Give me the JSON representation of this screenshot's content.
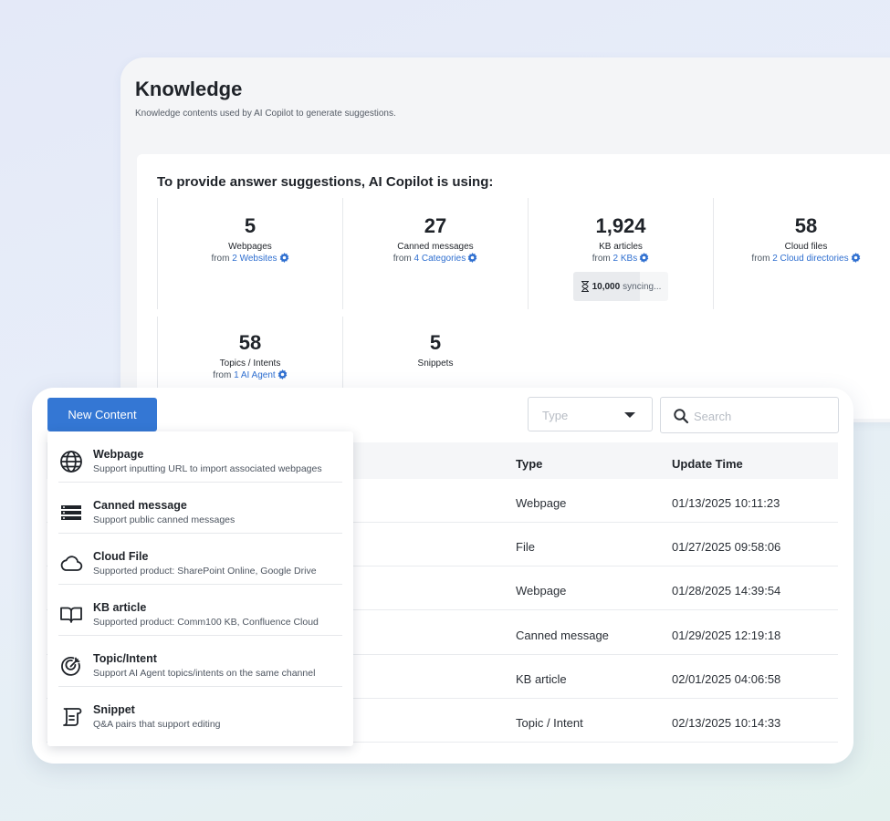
{
  "knowledge": {
    "title": "Knowledge",
    "subtitle": "Knowledge contents used by AI Copilot to generate suggestions."
  },
  "stats": {
    "heading": "To provide answer suggestions, AI Copilot is using:",
    "items": [
      {
        "count": "5",
        "label": "Webpages",
        "from_prefix": "from",
        "from_link": "2 Websites"
      },
      {
        "count": "27",
        "label": "Canned messages",
        "from_prefix": "from",
        "from_link": "4 Categories"
      },
      {
        "count": "1,924",
        "label": "KB articles",
        "from_prefix": "from",
        "from_link": "2 KBs"
      },
      {
        "count": "58",
        "label": "Cloud files",
        "from_prefix": "from",
        "from_link": "2 Cloud directories"
      },
      {
        "count": "58",
        "label": "Topics / Intents",
        "from_prefix": "from",
        "from_link": "1 AI Agent"
      },
      {
        "count": "5",
        "label": "Snippets"
      }
    ],
    "sync": {
      "count": "10,000",
      "text": "syncing..."
    }
  },
  "toolbar": {
    "new_content": "New Content",
    "type_placeholder": "Type",
    "search_placeholder": "Search"
  },
  "menu": {
    "items": [
      {
        "title": "Webpage",
        "desc": "Support inputting URL to import associated webpages",
        "icon": "globe-icon"
      },
      {
        "title": "Canned message",
        "desc": "Support public canned messages",
        "icon": "canned-message-icon"
      },
      {
        "title": "Cloud File",
        "desc": "Supported product: SharePoint Online, Google Drive",
        "icon": "cloud-icon"
      },
      {
        "title": "KB article",
        "desc": "Supported product: Comm100 KB, Confluence Cloud",
        "icon": "book-icon"
      },
      {
        "title": "Topic/Intent",
        "desc": "Support AI Agent topics/intents on the same channel",
        "icon": "target-icon"
      },
      {
        "title": "Snippet",
        "desc": "Q&A pairs that support editing",
        "icon": "scroll-icon"
      }
    ]
  },
  "table": {
    "headers": {
      "type": "Type",
      "update_time": "Update Time"
    },
    "rows": [
      {
        "type": "Webpage",
        "time": "01/13/2025 10:11:23"
      },
      {
        "type": "File",
        "time": "01/27/2025 09:58:06"
      },
      {
        "type": "Webpage",
        "time": "01/28/2025 14:39:54"
      },
      {
        "type": "Canned message",
        "time": "01/29/2025 12:19:18"
      },
      {
        "type": "KB article",
        "time": "02/01/2025 04:06:58"
      },
      {
        "type": "Topic / Intent",
        "time": "02/13/2025 10:14:33"
      }
    ]
  },
  "colors": {
    "accent": "#3477d4",
    "link": "#2f6fd0"
  }
}
